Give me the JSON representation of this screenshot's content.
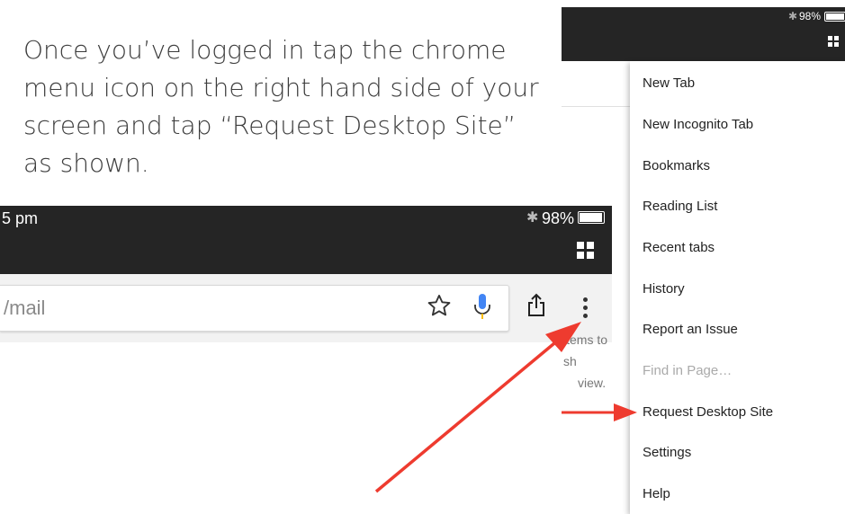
{
  "instruction": {
    "number": ".",
    "lines": [
      "Once you’ve logged in tap the chrome",
      "menu icon on the right hand side of your",
      "screen and tap “Request Desktop Site”",
      "as shown."
    ]
  },
  "left_screen": {
    "time": "5 pm",
    "battery_text": "98%",
    "battery_level": 0.98,
    "url_text": "/mail",
    "items_text": [
      "items to sh",
      "view."
    ],
    "icons": [
      "bluetooth-icon",
      "battery-icon",
      "tabs-icon",
      "star-icon",
      "microphone-icon",
      "share-icon",
      "more-vert-icon"
    ]
  },
  "right_screen": {
    "battery_text": "98%",
    "items_text": [
      "",
      ""
    ],
    "menu": [
      "New Tab",
      "New Incognito Tab",
      "Bookmarks",
      "Reading List",
      "Recent tabs",
      "History",
      "Report an Issue",
      "Find in Page…",
      "Request Desktop Site",
      "Settings",
      "Help"
    ],
    "disabled_item": "Find in Page…"
  },
  "colors": {
    "bar": "#252525",
    "arrow": "#ee3b2f",
    "mic_blue": "#4285f4",
    "mic_yellow": "#fbbc05"
  }
}
